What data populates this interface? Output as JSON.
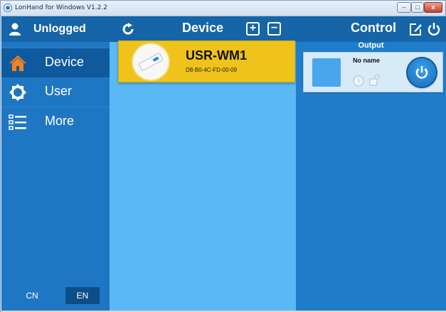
{
  "window": {
    "title": "LonHand for Windows V1.2.2",
    "minimize_glyph": "–",
    "maximize_glyph": "□",
    "close_glyph": "x"
  },
  "sidebar": {
    "user_status": "Unlogged",
    "items": [
      {
        "label": "Device",
        "icon": "home-icon",
        "selected": true
      },
      {
        "label": "User",
        "icon": "gear-icon",
        "selected": false
      },
      {
        "label": "More",
        "icon": "list-icon",
        "selected": false
      }
    ],
    "languages": [
      {
        "label": "CN",
        "selected": false
      },
      {
        "label": "EN",
        "selected": true
      }
    ]
  },
  "device_panel": {
    "title": "Device",
    "add_glyph": "+",
    "remove_glyph": "−",
    "devices": [
      {
        "name": "USR-WM1",
        "mac": "D8-B0-4C-FD-00-09"
      }
    ]
  },
  "control_panel": {
    "title": "Control",
    "section_label": "Output",
    "outputs": [
      {
        "name": "No name"
      }
    ]
  },
  "colors": {
    "header_bg": "#1565a8",
    "sidebar_bg": "#1f77c4",
    "device_list_bg": "#5ab8f5",
    "device_card_bg": "#efc31a",
    "control_bg": "#1f7dc9"
  }
}
